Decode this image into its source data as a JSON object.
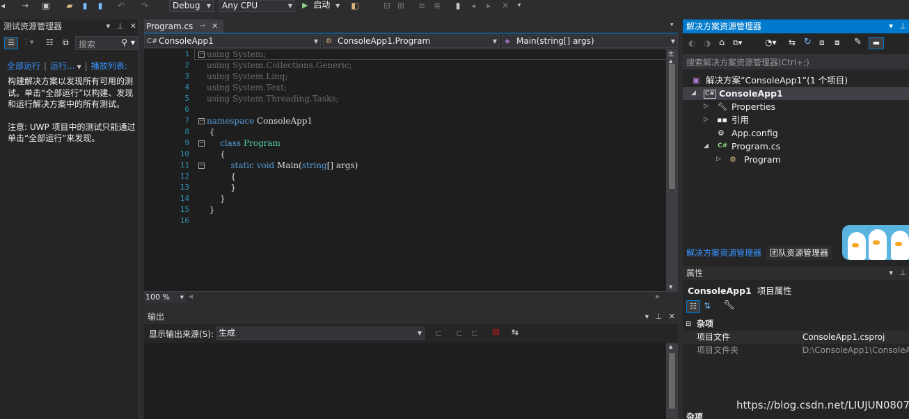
{
  "toolbar": {
    "config": "Debug",
    "platform": "Any CPU",
    "start_label": "启动"
  },
  "test_explorer": {
    "title": "测试资源管理器",
    "search_placeholder": "搜索",
    "run_all": "全部运行",
    "run": "运行...",
    "playlist": "播放列表:",
    "info1": "构建解决方案以发现所有可用的测试。单击“全部运行”以构建、发现和运行解决方案中的所有测试。",
    "info2": "注意: UWP 项目中的测试只能通过单击“全部运行”来发现。"
  },
  "editor": {
    "tab_label": "Program.cs",
    "nav_project": "ConsoleApp1",
    "nav_class": "ConsoleApp1.Program",
    "nav_member": "Main(string[] args)",
    "zoom": "100 %",
    "line_numbers": [
      "1",
      "2",
      "3",
      "4",
      "5",
      "6",
      "7",
      "8",
      "9",
      "10",
      "11",
      "12",
      "13",
      "14",
      "15",
      "16"
    ]
  },
  "output": {
    "title": "输出",
    "source_label": "显示输出来源(S):",
    "source_value": "生成"
  },
  "solution_explorer": {
    "title": "解决方案资源管理器",
    "search_placeholder": "搜索解决方案资源管理器(Ctrl+;)",
    "solution": "解决方案“ConsoleApp1”(1 个项目)",
    "project": "ConsoleApp1",
    "properties": "Properties",
    "references": "引用",
    "app_config": "App.config",
    "program_cs": "Program.cs",
    "program_class": "Program",
    "tab_active": "解决方案资源管理器",
    "tab_team": "团队资源管理器"
  },
  "properties": {
    "title": "属性",
    "header_name": "ConsoleApp1",
    "header_type": "项目属性",
    "category": "杂项",
    "rows": [
      {
        "name": "项目文件",
        "value": "ConsoleApp1.csproj"
      },
      {
        "name": "项目文件夹",
        "value": "D:\\ConsoleApp1\\ConsoleA"
      }
    ],
    "footer_category": "杂项"
  },
  "watermark": "https://blog.csdn.net/LIUJUN0807",
  "colors": {
    "accent": "#007acc",
    "keyword": "#569cd6",
    "type": "#4ec9b0",
    "line_number": "#2b91af",
    "link": "#3794ff"
  }
}
